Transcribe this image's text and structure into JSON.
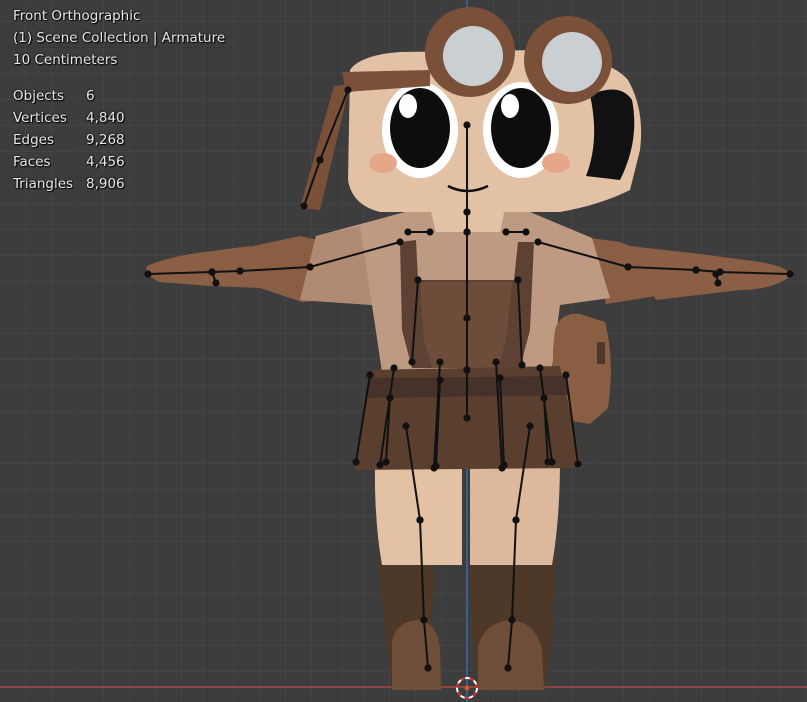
{
  "viewport": {
    "view_name": "Front Orthographic",
    "collection_line": "(1) Scene Collection | Armature",
    "scale_text": "10 Centimeters"
  },
  "stats": [
    {
      "label": "Objects",
      "value": "6"
    },
    {
      "label": "Vertices",
      "value": "4,840"
    },
    {
      "label": "Edges",
      "value": "9,268"
    },
    {
      "label": "Faces",
      "value": "4,456"
    },
    {
      "label": "Triangles",
      "value": "8,906"
    }
  ],
  "colors": {
    "background": "#3d3d3d",
    "x_axis": "#c0474d",
    "z_axis": "#3b6fc0",
    "skin": "#e2c1a4",
    "shirt": "#bf9a83",
    "brown": "#8a5e43",
    "dark_brown": "#4b372b",
    "bone": "#111111"
  },
  "icons": [
    "3d-cursor-icon"
  ]
}
